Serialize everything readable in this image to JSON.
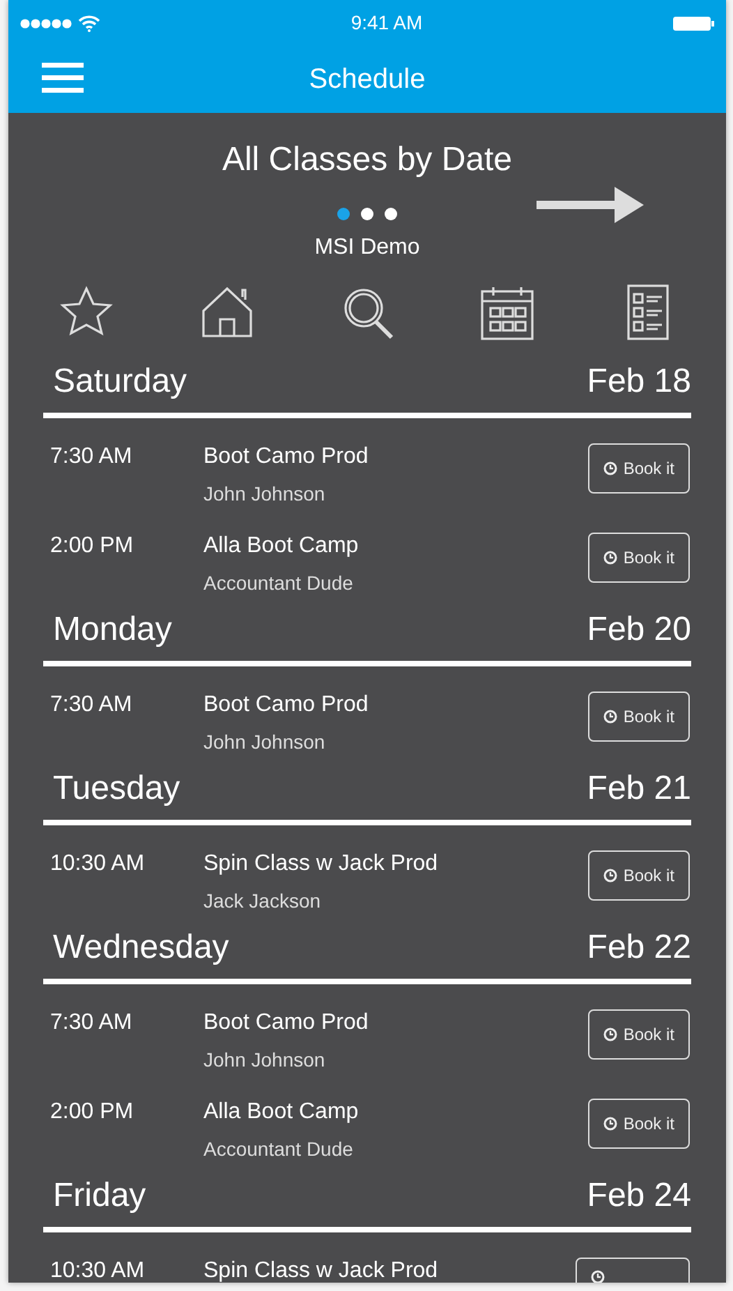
{
  "status_bar": {
    "time": "9:41 AM"
  },
  "nav": {
    "title": "Schedule"
  },
  "header": {
    "title": "All Classes by Date",
    "subtitle": "MSI Demo",
    "pages": [
      {
        "selected": true
      },
      {
        "selected": false
      },
      {
        "selected": false
      }
    ]
  },
  "days": [
    {
      "day": "Saturday",
      "date": "Feb 18",
      "classes": [
        {
          "time": "7:30 AM",
          "name": "Boot Camo Prod",
          "instructor": "John Johnson",
          "button": "Book it"
        },
        {
          "time": "2:00 PM",
          "name": "Alla Boot Camp",
          "instructor": "Accountant Dude",
          "button": "Book it"
        }
      ]
    },
    {
      "day": "Monday",
      "date": "Feb 20",
      "classes": [
        {
          "time": "7:30 AM",
          "name": "Boot Camo Prod",
          "instructor": "John Johnson",
          "button": "Book it"
        }
      ]
    },
    {
      "day": "Tuesday",
      "date": "Feb 21",
      "classes": [
        {
          "time": "10:30 AM",
          "name": "Spin Class w Jack Prod",
          "instructor": "Jack Jackson",
          "button": "Book it"
        }
      ]
    },
    {
      "day": "Wednesday",
      "date": "Feb 22",
      "classes": [
        {
          "time": "7:30 AM",
          "name": "Boot Camo Prod",
          "instructor": "John Johnson",
          "button": "Book it"
        },
        {
          "time": "2:00 PM",
          "name": "Alla Boot Camp",
          "instructor": "Accountant Dude",
          "button": "Book it"
        }
      ]
    },
    {
      "day": "Friday",
      "date": "Feb 24",
      "classes": [
        {
          "time": "10:30 AM",
          "name": "Spin Class w Jack Prod"
        }
      ]
    }
  ]
}
